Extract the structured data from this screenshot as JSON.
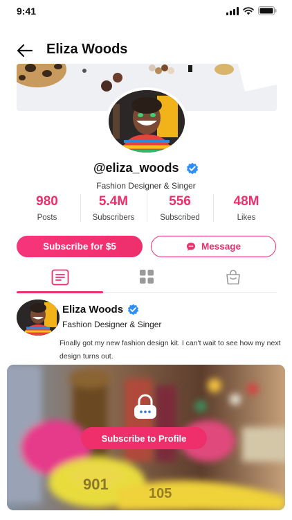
{
  "status_bar": {
    "time": "9:41"
  },
  "header": {
    "title": "Eliza Woods"
  },
  "profile": {
    "handle": "@eliza_woods",
    "bio": "Fashion Designer & Singer"
  },
  "stats": [
    {
      "value": "980",
      "label": "Posts"
    },
    {
      "value": "5.4M",
      "label": "Subscribers"
    },
    {
      "value": "556",
      "label": "Subscribed"
    },
    {
      "value": "48M",
      "label": "Likes"
    }
  ],
  "actions": {
    "subscribe_label": "Subscribe for $5",
    "message_label": "Message"
  },
  "tabs": [
    {
      "icon": "document-icon",
      "active": true
    },
    {
      "icon": "grid-icon",
      "active": false
    },
    {
      "icon": "bag-icon",
      "active": false
    }
  ],
  "post": {
    "author": "Eliza Woods",
    "subtitle": "Fashion Designer & Singer",
    "text": "Finally got my new fashion design kit. I can't wait to see how my next design turns out.",
    "locked_cta": "Subscribe to Profile"
  },
  "colors": {
    "accent": "#ee2f6c",
    "verified": "#2f8ef5"
  }
}
